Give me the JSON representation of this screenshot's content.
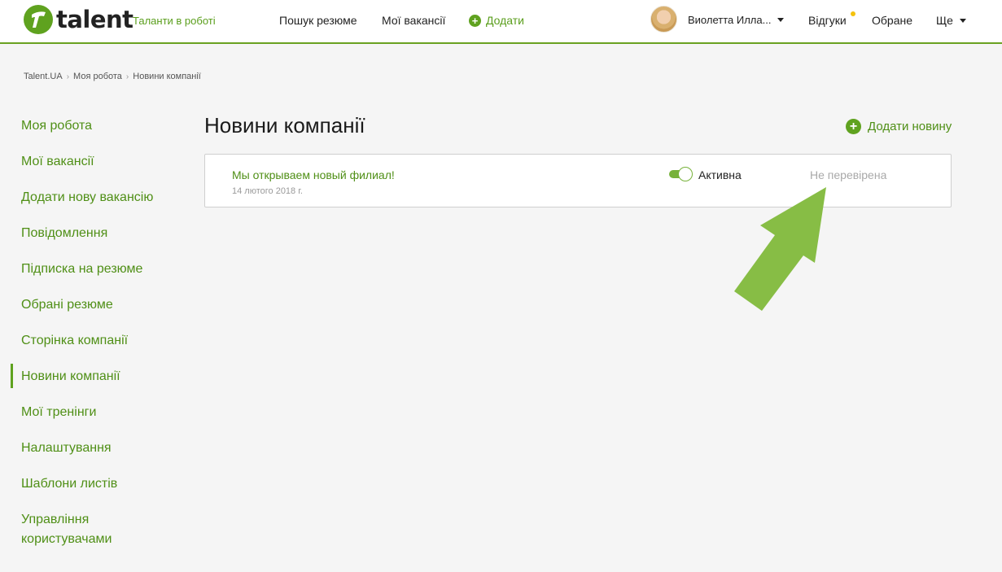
{
  "header": {
    "logo_text": "talent",
    "tagline": "Таланти в роботі",
    "nav": {
      "search_resume": "Пошук резюме",
      "my_vacancies": "Мої вакансії",
      "add": "Додати"
    },
    "user_name": "Виолетта Илла...",
    "reviews": "Відгуки",
    "favorites": "Обране",
    "more": "Ще"
  },
  "breadcrumb": [
    "Talent.UA",
    "Моя робота",
    "Новини компанії"
  ],
  "sidebar": {
    "items": [
      {
        "label": "Моя робота"
      },
      {
        "label": "Мої вакансії"
      },
      {
        "label": "Додати нову вакансію"
      },
      {
        "label": "Повідомлення"
      },
      {
        "label": "Підписка на резюме"
      },
      {
        "label": "Обрані резюме"
      },
      {
        "label": "Сторінка компанії"
      },
      {
        "label": "Новини компанії"
      },
      {
        "label": "Мої тренінги"
      },
      {
        "label": "Налаштування"
      },
      {
        "label": "Шаблони листів"
      },
      {
        "label": "Управління користувачами"
      }
    ],
    "active_index": 7
  },
  "main": {
    "title": "Новини компанії",
    "add_news": "Додати новину",
    "news": [
      {
        "title": "Мы открываем новый филиал!",
        "date": "14 лютого 2018 г.",
        "toggle_state": "on",
        "toggle_label": "Активна",
        "status": "Не перевірена"
      }
    ]
  },
  "colors": {
    "brand_green": "#5fa21f",
    "link_green": "#4f8f16",
    "arrow_green": "#87bd45",
    "notification_dot": "#f4c20d",
    "status_gray": "#a9a9a9"
  },
  "icons": [
    "logo-icon",
    "plus-icon",
    "avatar",
    "chevron-down-icon",
    "notification-dot",
    "arrow-annotation"
  ]
}
